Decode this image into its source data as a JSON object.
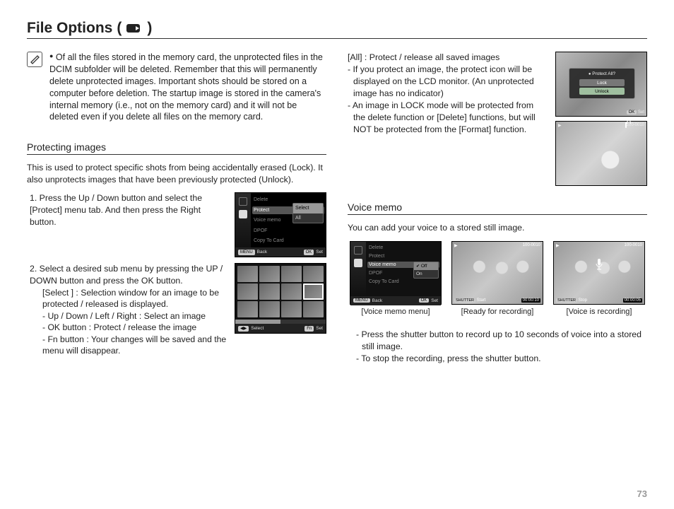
{
  "title": "File Options",
  "title_paren_open": "(",
  "title_paren_close": ")",
  "note": "Of all the files stored in the memory card, the unprotected files in the DCIM subfolder will be deleted. Remember that this will permanently delete unprotected images. Important shots should be stored on a computer before deletion. The startup image is stored in the camera's internal memory (i.e., not on the memory card) and it will not be deleted even if you delete all files on the memory card.",
  "section_protecting": "Protecting images",
  "protecting_intro": "This is used to protect specific shots from being accidentally erased (Lock). It also unprotects images that have been previously protected (Unlock).",
  "step1": "1. Press the Up / Down button and select the [Protect] menu tab. And then press the Right button.",
  "step2": "2. Select a desired sub menu by pressing the UP / DOWN button and press the OK button.",
  "step2_sub_select": "[Select ] : Selection window for an image to be protected / released is displayed.",
  "step2_sub_udlr": "- Up / Down / Left / Right : Select an image",
  "step2_sub_ok": "- OK button : Protect / release the image",
  "step2_sub_fn": "- Fn button : Your changes will be saved and the menu will disappear.",
  "menu": {
    "delete": "Delete",
    "protect": "Protect",
    "voicememo": "Voice memo",
    "dpof": "DPOF",
    "copy": "Copy To Card",
    "sub_select": "Select",
    "sub_all": "All"
  },
  "footer": {
    "back": "Back",
    "set": "Set",
    "select": "Select",
    "ok": "OK",
    "menu": "MENU",
    "arrows": "◀▶",
    "fn": "Fn",
    "shutter": "SHUTTER",
    "start": "Start",
    "stop": "Stop"
  },
  "right": {
    "all_line": "[All] : Protect / release all saved images",
    "l1": "- If you protect an image, the protect icon will be displayed on the LCD monitor. (An unprotected image has no indicator)",
    "l2": "- An image in LOCK mode will be protected from the delete function or [Delete] functions, but will NOT be protected from the [Format] function.",
    "dialog_title": "Protect All?",
    "dialog_lock": "Lock",
    "dialog_unlock": "Unlock",
    "photo_counter": "100-0010"
  },
  "voice": {
    "heading": "Voice memo",
    "intro": "You can add your voice to a stored still image.",
    "sub_off": "Off",
    "sub_on": "On",
    "cap_menu": "[Voice memo menu]",
    "cap_ready": "[Ready for recording]",
    "cap_rec": "[Voice is recording]",
    "timer_ready": "00:00:10",
    "timer_rec": "00:00:05",
    "post1": "- Press the shutter button to record up to 10 seconds of voice into a stored still image.",
    "post2": "- To stop the recording, press the shutter button."
  },
  "page_number": "73"
}
